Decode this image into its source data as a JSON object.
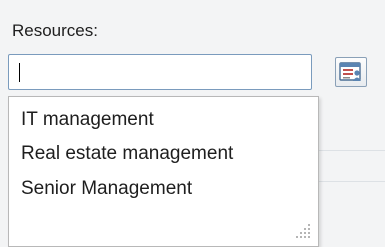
{
  "field": {
    "label": "Resources:",
    "value": "",
    "picker_icon": "address-book-icon"
  },
  "dropdown": {
    "options": [
      "IT management",
      "Real estate management",
      "Senior Management"
    ],
    "resize_icon": "resize-grip-icon"
  }
}
